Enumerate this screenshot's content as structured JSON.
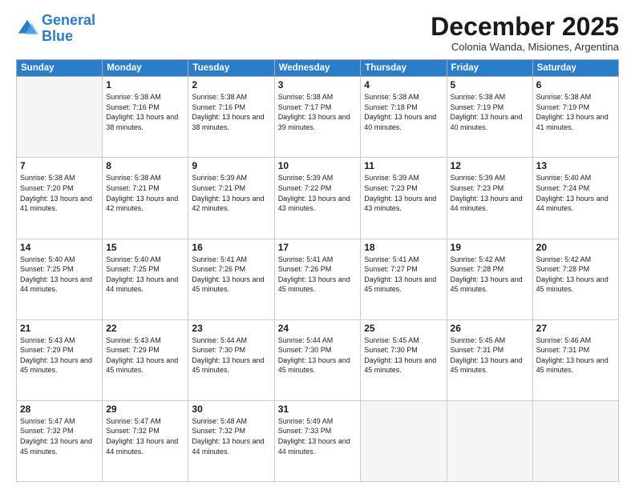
{
  "logo": {
    "text_general": "General",
    "text_blue": "Blue"
  },
  "header": {
    "month": "December 2025",
    "location": "Colonia Wanda, Misiones, Argentina"
  },
  "days_of_week": [
    "Sunday",
    "Monday",
    "Tuesday",
    "Wednesday",
    "Thursday",
    "Friday",
    "Saturday"
  ],
  "weeks": [
    [
      {
        "day": "",
        "empty": true
      },
      {
        "day": "1",
        "sunrise": "5:38 AM",
        "sunset": "7:16 PM",
        "daylight": "13 hours and 38 minutes."
      },
      {
        "day": "2",
        "sunrise": "5:38 AM",
        "sunset": "7:16 PM",
        "daylight": "13 hours and 38 minutes."
      },
      {
        "day": "3",
        "sunrise": "5:38 AM",
        "sunset": "7:17 PM",
        "daylight": "13 hours and 39 minutes."
      },
      {
        "day": "4",
        "sunrise": "5:38 AM",
        "sunset": "7:18 PM",
        "daylight": "13 hours and 40 minutes."
      },
      {
        "day": "5",
        "sunrise": "5:38 AM",
        "sunset": "7:19 PM",
        "daylight": "13 hours and 40 minutes."
      },
      {
        "day": "6",
        "sunrise": "5:38 AM",
        "sunset": "7:19 PM",
        "daylight": "13 hours and 41 minutes."
      }
    ],
    [
      {
        "day": "7",
        "sunrise": "5:38 AM",
        "sunset": "7:20 PM",
        "daylight": "13 hours and 41 minutes."
      },
      {
        "day": "8",
        "sunrise": "5:38 AM",
        "sunset": "7:21 PM",
        "daylight": "13 hours and 42 minutes."
      },
      {
        "day": "9",
        "sunrise": "5:39 AM",
        "sunset": "7:21 PM",
        "daylight": "13 hours and 42 minutes."
      },
      {
        "day": "10",
        "sunrise": "5:39 AM",
        "sunset": "7:22 PM",
        "daylight": "13 hours and 43 minutes."
      },
      {
        "day": "11",
        "sunrise": "5:39 AM",
        "sunset": "7:23 PM",
        "daylight": "13 hours and 43 minutes."
      },
      {
        "day": "12",
        "sunrise": "5:39 AM",
        "sunset": "7:23 PM",
        "daylight": "13 hours and 44 minutes."
      },
      {
        "day": "13",
        "sunrise": "5:40 AM",
        "sunset": "7:24 PM",
        "daylight": "13 hours and 44 minutes."
      }
    ],
    [
      {
        "day": "14",
        "sunrise": "5:40 AM",
        "sunset": "7:25 PM",
        "daylight": "13 hours and 44 minutes."
      },
      {
        "day": "15",
        "sunrise": "5:40 AM",
        "sunset": "7:25 PM",
        "daylight": "13 hours and 44 minutes."
      },
      {
        "day": "16",
        "sunrise": "5:41 AM",
        "sunset": "7:26 PM",
        "daylight": "13 hours and 45 minutes."
      },
      {
        "day": "17",
        "sunrise": "5:41 AM",
        "sunset": "7:26 PM",
        "daylight": "13 hours and 45 minutes."
      },
      {
        "day": "18",
        "sunrise": "5:41 AM",
        "sunset": "7:27 PM",
        "daylight": "13 hours and 45 minutes."
      },
      {
        "day": "19",
        "sunrise": "5:42 AM",
        "sunset": "7:28 PM",
        "daylight": "13 hours and 45 minutes."
      },
      {
        "day": "20",
        "sunrise": "5:42 AM",
        "sunset": "7:28 PM",
        "daylight": "13 hours and 45 minutes."
      }
    ],
    [
      {
        "day": "21",
        "sunrise": "5:43 AM",
        "sunset": "7:29 PM",
        "daylight": "13 hours and 45 minutes."
      },
      {
        "day": "22",
        "sunrise": "5:43 AM",
        "sunset": "7:29 PM",
        "daylight": "13 hours and 45 minutes."
      },
      {
        "day": "23",
        "sunrise": "5:44 AM",
        "sunset": "7:30 PM",
        "daylight": "13 hours and 45 minutes."
      },
      {
        "day": "24",
        "sunrise": "5:44 AM",
        "sunset": "7:30 PM",
        "daylight": "13 hours and 45 minutes."
      },
      {
        "day": "25",
        "sunrise": "5:45 AM",
        "sunset": "7:30 PM",
        "daylight": "13 hours and 45 minutes."
      },
      {
        "day": "26",
        "sunrise": "5:45 AM",
        "sunset": "7:31 PM",
        "daylight": "13 hours and 45 minutes."
      },
      {
        "day": "27",
        "sunrise": "5:46 AM",
        "sunset": "7:31 PM",
        "daylight": "13 hours and 45 minutes."
      }
    ],
    [
      {
        "day": "28",
        "sunrise": "5:47 AM",
        "sunset": "7:32 PM",
        "daylight": "13 hours and 45 minutes."
      },
      {
        "day": "29",
        "sunrise": "5:47 AM",
        "sunset": "7:32 PM",
        "daylight": "13 hours and 44 minutes."
      },
      {
        "day": "30",
        "sunrise": "5:48 AM",
        "sunset": "7:32 PM",
        "daylight": "13 hours and 44 minutes."
      },
      {
        "day": "31",
        "sunrise": "5:49 AM",
        "sunset": "7:33 PM",
        "daylight": "13 hours and 44 minutes."
      },
      {
        "day": "",
        "empty": true
      },
      {
        "day": "",
        "empty": true
      },
      {
        "day": "",
        "empty": true
      }
    ]
  ],
  "labels": {
    "sunrise_prefix": "Sunrise: ",
    "sunset_prefix": "Sunset: ",
    "daylight_prefix": "Daylight: "
  }
}
